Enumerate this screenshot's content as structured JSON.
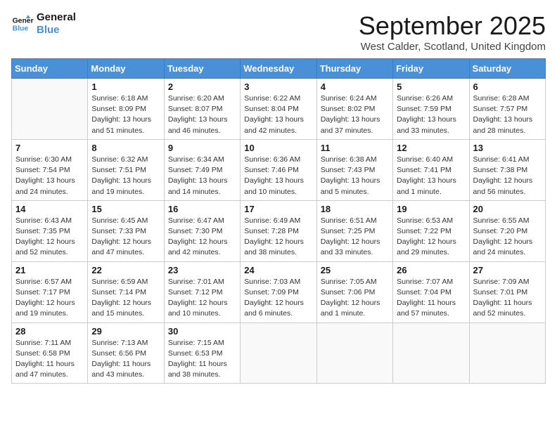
{
  "header": {
    "logo_line1": "General",
    "logo_line2": "Blue",
    "month_title": "September 2025",
    "location": "West Calder, Scotland, United Kingdom"
  },
  "weekdays": [
    "Sunday",
    "Monday",
    "Tuesday",
    "Wednesday",
    "Thursday",
    "Friday",
    "Saturday"
  ],
  "weeks": [
    [
      {
        "day": "",
        "info": ""
      },
      {
        "day": "1",
        "info": "Sunrise: 6:18 AM\nSunset: 8:09 PM\nDaylight: 13 hours\nand 51 minutes."
      },
      {
        "day": "2",
        "info": "Sunrise: 6:20 AM\nSunset: 8:07 PM\nDaylight: 13 hours\nand 46 minutes."
      },
      {
        "day": "3",
        "info": "Sunrise: 6:22 AM\nSunset: 8:04 PM\nDaylight: 13 hours\nand 42 minutes."
      },
      {
        "day": "4",
        "info": "Sunrise: 6:24 AM\nSunset: 8:02 PM\nDaylight: 13 hours\nand 37 minutes."
      },
      {
        "day": "5",
        "info": "Sunrise: 6:26 AM\nSunset: 7:59 PM\nDaylight: 13 hours\nand 33 minutes."
      },
      {
        "day": "6",
        "info": "Sunrise: 6:28 AM\nSunset: 7:57 PM\nDaylight: 13 hours\nand 28 minutes."
      }
    ],
    [
      {
        "day": "7",
        "info": "Sunrise: 6:30 AM\nSunset: 7:54 PM\nDaylight: 13 hours\nand 24 minutes."
      },
      {
        "day": "8",
        "info": "Sunrise: 6:32 AM\nSunset: 7:51 PM\nDaylight: 13 hours\nand 19 minutes."
      },
      {
        "day": "9",
        "info": "Sunrise: 6:34 AM\nSunset: 7:49 PM\nDaylight: 13 hours\nand 14 minutes."
      },
      {
        "day": "10",
        "info": "Sunrise: 6:36 AM\nSunset: 7:46 PM\nDaylight: 13 hours\nand 10 minutes."
      },
      {
        "day": "11",
        "info": "Sunrise: 6:38 AM\nSunset: 7:43 PM\nDaylight: 13 hours\nand 5 minutes."
      },
      {
        "day": "12",
        "info": "Sunrise: 6:40 AM\nSunset: 7:41 PM\nDaylight: 13 hours\nand 1 minute."
      },
      {
        "day": "13",
        "info": "Sunrise: 6:41 AM\nSunset: 7:38 PM\nDaylight: 12 hours\nand 56 minutes."
      }
    ],
    [
      {
        "day": "14",
        "info": "Sunrise: 6:43 AM\nSunset: 7:35 PM\nDaylight: 12 hours\nand 52 minutes."
      },
      {
        "day": "15",
        "info": "Sunrise: 6:45 AM\nSunset: 7:33 PM\nDaylight: 12 hours\nand 47 minutes."
      },
      {
        "day": "16",
        "info": "Sunrise: 6:47 AM\nSunset: 7:30 PM\nDaylight: 12 hours\nand 42 minutes."
      },
      {
        "day": "17",
        "info": "Sunrise: 6:49 AM\nSunset: 7:28 PM\nDaylight: 12 hours\nand 38 minutes."
      },
      {
        "day": "18",
        "info": "Sunrise: 6:51 AM\nSunset: 7:25 PM\nDaylight: 12 hours\nand 33 minutes."
      },
      {
        "day": "19",
        "info": "Sunrise: 6:53 AM\nSunset: 7:22 PM\nDaylight: 12 hours\nand 29 minutes."
      },
      {
        "day": "20",
        "info": "Sunrise: 6:55 AM\nSunset: 7:20 PM\nDaylight: 12 hours\nand 24 minutes."
      }
    ],
    [
      {
        "day": "21",
        "info": "Sunrise: 6:57 AM\nSunset: 7:17 PM\nDaylight: 12 hours\nand 19 minutes."
      },
      {
        "day": "22",
        "info": "Sunrise: 6:59 AM\nSunset: 7:14 PM\nDaylight: 12 hours\nand 15 minutes."
      },
      {
        "day": "23",
        "info": "Sunrise: 7:01 AM\nSunset: 7:12 PM\nDaylight: 12 hours\nand 10 minutes."
      },
      {
        "day": "24",
        "info": "Sunrise: 7:03 AM\nSunset: 7:09 PM\nDaylight: 12 hours\nand 6 minutes."
      },
      {
        "day": "25",
        "info": "Sunrise: 7:05 AM\nSunset: 7:06 PM\nDaylight: 12 hours\nand 1 minute."
      },
      {
        "day": "26",
        "info": "Sunrise: 7:07 AM\nSunset: 7:04 PM\nDaylight: 11 hours\nand 57 minutes."
      },
      {
        "day": "27",
        "info": "Sunrise: 7:09 AM\nSunset: 7:01 PM\nDaylight: 11 hours\nand 52 minutes."
      }
    ],
    [
      {
        "day": "28",
        "info": "Sunrise: 7:11 AM\nSunset: 6:58 PM\nDaylight: 11 hours\nand 47 minutes."
      },
      {
        "day": "29",
        "info": "Sunrise: 7:13 AM\nSunset: 6:56 PM\nDaylight: 11 hours\nand 43 minutes."
      },
      {
        "day": "30",
        "info": "Sunrise: 7:15 AM\nSunset: 6:53 PM\nDaylight: 11 hours\nand 38 minutes."
      },
      {
        "day": "",
        "info": ""
      },
      {
        "day": "",
        "info": ""
      },
      {
        "day": "",
        "info": ""
      },
      {
        "day": "",
        "info": ""
      }
    ]
  ]
}
